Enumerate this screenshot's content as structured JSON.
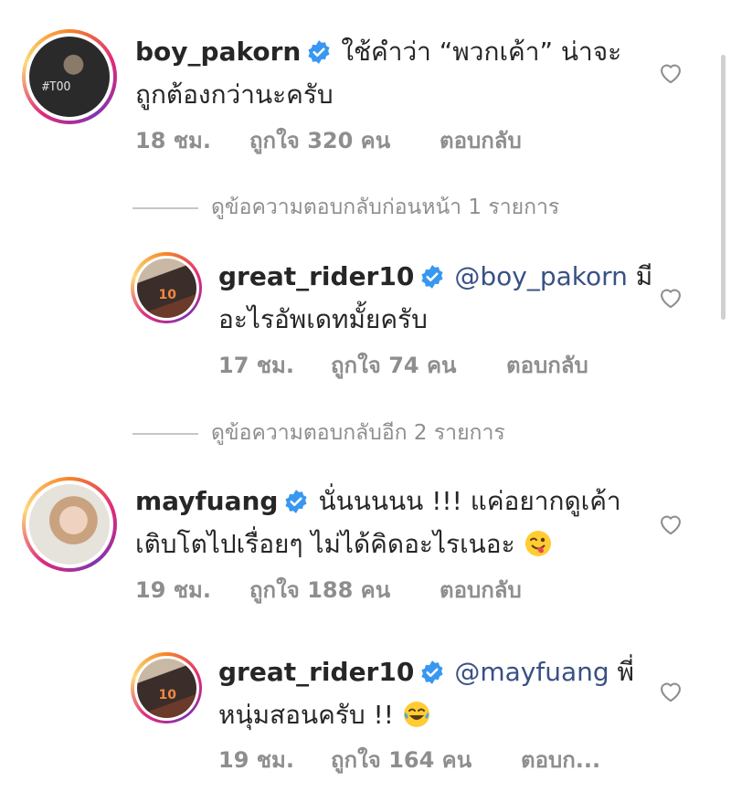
{
  "comments": [
    {
      "username": "boy_pakorn",
      "text_line1": "ใช้คำว่า “พวกเค้า” น่าจะ",
      "text_line2": "ถูกต้องกว่านะครับ",
      "time": "18 ชม.",
      "likes": "ถูกใจ 320 คน",
      "reply": "ตอบกลับ",
      "avatar_text": "#TOO"
    },
    {
      "username": "great_rider10",
      "mention": "@boy_pakorn",
      "text_after_mention": " มี",
      "text_line2": "อะไรอัพเดทมั้ยครับ",
      "time": "17 ชม.",
      "likes": "ถูกใจ 74 คน",
      "reply": "ตอบกลับ",
      "avatar_text": "10"
    },
    {
      "username": "mayfuang",
      "text_line1": "นั่นนนนน !!! แค่อยากดูเค้า",
      "text_line2": "เติบโตไปเรื่อยๆ ไม่ได้คิดอะไรเนอะ",
      "time": "19 ชม.",
      "likes": "ถูกใจ 188 คน",
      "reply": "ตอบกลับ",
      "emoji": "winking-tongue-face"
    },
    {
      "username": "great_rider10",
      "mention": "@mayfuang",
      "text_after_mention": " พี่",
      "text_line2": "หนุ่มสอนครับ !!",
      "time": "19 ชม.",
      "likes": "ถูกใจ 164 คน",
      "reply": "ตอบก...",
      "avatar_text": "10",
      "emoji": "tears-of-joy-face"
    }
  ],
  "view_previous_replies": "ดูข้อความตอบกลับก่อนหน้า 1 รายการ",
  "view_more_replies": "ดูข้อความตอบกลับอีก 2 รายการ",
  "colors": {
    "verified": "#3897f0",
    "mention": "#385185",
    "meta": "#8e8e8e"
  }
}
